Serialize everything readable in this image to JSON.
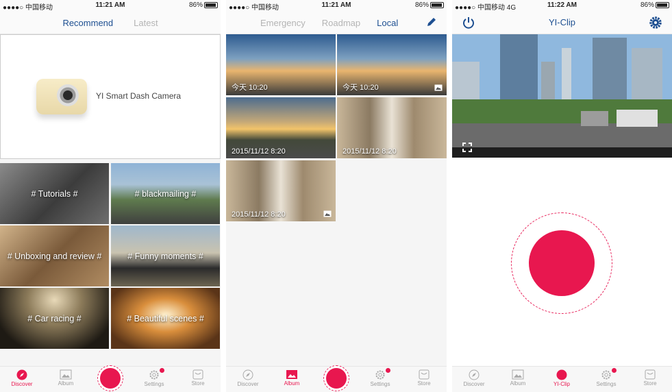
{
  "screens": [
    {
      "status": {
        "carrier": "●●●●○ 中国移动",
        "time": "11:21 AM",
        "battery": "86%",
        "battery_level": 0.86
      },
      "tabs": [
        {
          "label": "Recommend",
          "active": true
        },
        {
          "label": "Latest",
          "active": false
        }
      ],
      "hero": {
        "title": "YI Smart Dash Camera"
      },
      "categories": [
        "# Tutorials #",
        "# blackmailing #",
        "# Unboxing and review #",
        "# Funny moments #",
        "# Car racing #",
        "# Beautiful scenes #"
      ],
      "nav": {
        "discover": "Discover",
        "album": "Album",
        "settings": "Settings",
        "store": "Store"
      }
    },
    {
      "status": {
        "carrier": "●●●●○ 中国移动",
        "time": "11:21 AM",
        "battery": "86%",
        "battery_level": 0.86
      },
      "tabs": [
        {
          "label": "Emergency",
          "active": false
        },
        {
          "label": "Roadmap",
          "active": false
        },
        {
          "label": "Local",
          "active": true
        }
      ],
      "thumbs": [
        {
          "caption": "今天  10:20",
          "has_icon": false
        },
        {
          "caption": "今天  10:20",
          "has_icon": true
        },
        {
          "caption": "2015/11/12  8:20",
          "has_icon": false
        },
        {
          "caption": "2015/11/12  8:20",
          "has_icon": false
        },
        {
          "caption": "2015/11/12  8:20",
          "has_icon": true
        }
      ],
      "nav": {
        "discover": "Discover",
        "album": "Album",
        "settings": "Settings",
        "store": "Store"
      }
    },
    {
      "status": {
        "carrier": "●●●●○ 中国移动  4G",
        "time": "11:22 AM",
        "battery": "86%",
        "battery_level": 0.86
      },
      "title": "YI-Clip",
      "nav": {
        "discover": "Discover",
        "album": "Album",
        "clip": "YI-Clip",
        "settings": "Settings",
        "store": "Store"
      }
    }
  ],
  "colors": {
    "accent": "#e8174f",
    "tab_active": "#1d4f91",
    "tab_inactive": "#b4b4b4",
    "nav_inactive": "#9a9a9a"
  }
}
